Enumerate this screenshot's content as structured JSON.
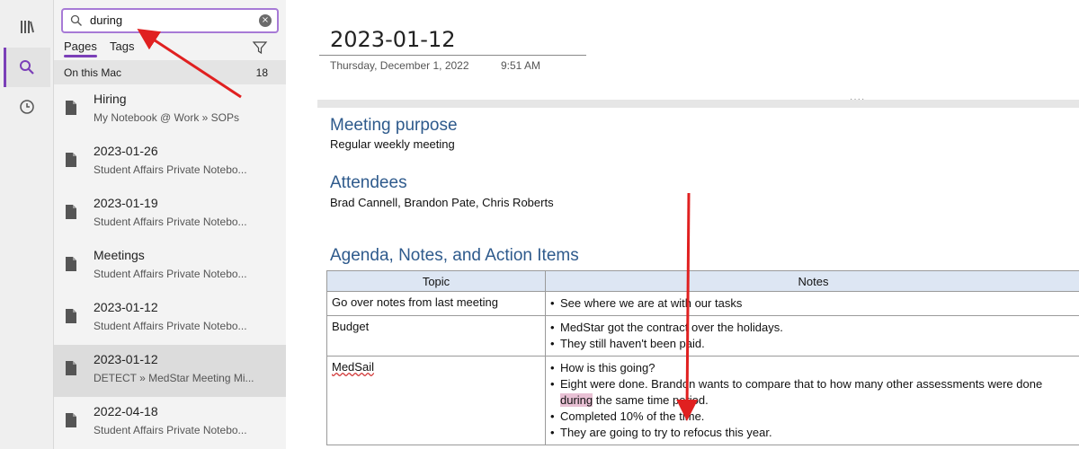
{
  "search": {
    "query": "during"
  },
  "tabs": {
    "pages": "Pages",
    "tags": "Tags"
  },
  "scope": {
    "label": "On this Mac",
    "count": "18"
  },
  "results": [
    {
      "title": "Hiring",
      "subtitle": "My Notebook @ Work » SOPs"
    },
    {
      "title": "2023-01-26",
      "subtitle": "Student Affairs Private Notebo..."
    },
    {
      "title": "2023-01-19",
      "subtitle": "Student Affairs Private Notebo..."
    },
    {
      "title": "Meetings",
      "subtitle": "Student Affairs Private Notebo..."
    },
    {
      "title": "2023-01-12",
      "subtitle": "Student Affairs Private Notebo..."
    },
    {
      "title": "2023-01-12",
      "subtitle": "DETECT » MedStar Meeting Mi..."
    },
    {
      "title": "2022-04-18",
      "subtitle": "Student Affairs Private Notebo..."
    }
  ],
  "page": {
    "title": "2023-01-12",
    "date": "Thursday, December 1, 2022",
    "time": "9:51 AM",
    "purpose_heading": "Meeting purpose",
    "purpose_text": "Regular weekly meeting",
    "attendees_heading": "Attendees",
    "attendees_text": "Brad Cannell, Brandon Pate, Chris Roberts",
    "agenda_heading": "Agenda, Notes, and Action Items",
    "table": {
      "headers": [
        "Topic",
        "Notes"
      ],
      "rows": [
        {
          "topic": "Go over notes from last meeting",
          "notes": [
            "See where we are at with our tasks"
          ]
        },
        {
          "topic": "Budget",
          "notes": [
            "MedStar got the contract over the holidays.",
            "They still haven't been paid."
          ]
        },
        {
          "topic": "MedSail",
          "notes": [
            "How is this going?",
            "Eight were done. Brandon wants to compare that to how many other assessments were done during the same time period.",
            "Completed 10% of the time.",
            "They are going to try to refocus this year."
          ]
        }
      ]
    }
  },
  "colors": {
    "accent": "#7b3fb8",
    "heading": "#2e5a8c",
    "arrow": "#e02020",
    "highlight": "#e8c0d4"
  },
  "icons": [
    "library-icon",
    "search-icon",
    "recent-icon",
    "magnifier-icon",
    "clear-icon",
    "filter-icon",
    "page-icon"
  ]
}
